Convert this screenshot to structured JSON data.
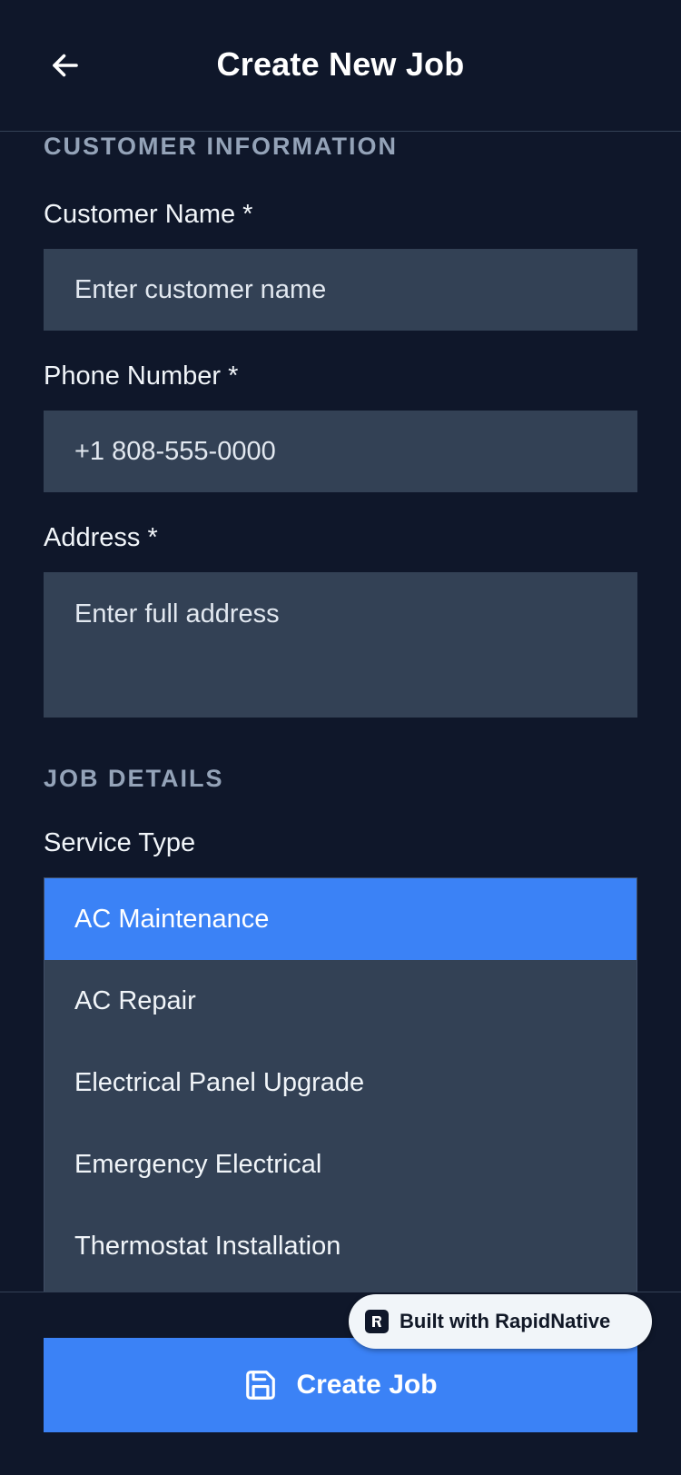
{
  "header": {
    "title": "Create New Job",
    "back_icon": "arrow-left-icon"
  },
  "customer_section": {
    "title": "CUSTOMER INFORMATION",
    "name": {
      "label": "Customer Name *",
      "placeholder": "Enter customer name",
      "value": ""
    },
    "phone": {
      "label": "Phone Number *",
      "placeholder": "+1 808-555-0000",
      "value": ""
    },
    "address": {
      "label": "Address *",
      "placeholder": "Enter full address",
      "value": ""
    }
  },
  "job_section": {
    "title": "JOB DETAILS",
    "service_type": {
      "label": "Service Type",
      "selected": "AC Maintenance",
      "options": [
        "AC Maintenance",
        "AC Repair",
        "Electrical Panel Upgrade",
        "Emergency Electrical",
        "Thermostat Installation"
      ]
    }
  },
  "footer": {
    "create_label": "Create Job",
    "create_icon": "save-icon"
  },
  "badge": {
    "label": "Built with RapidNative"
  },
  "colors": {
    "background": "#0F172A",
    "surface": "#334155",
    "accent": "#3B82F6",
    "section_title": "#94A3B8"
  }
}
